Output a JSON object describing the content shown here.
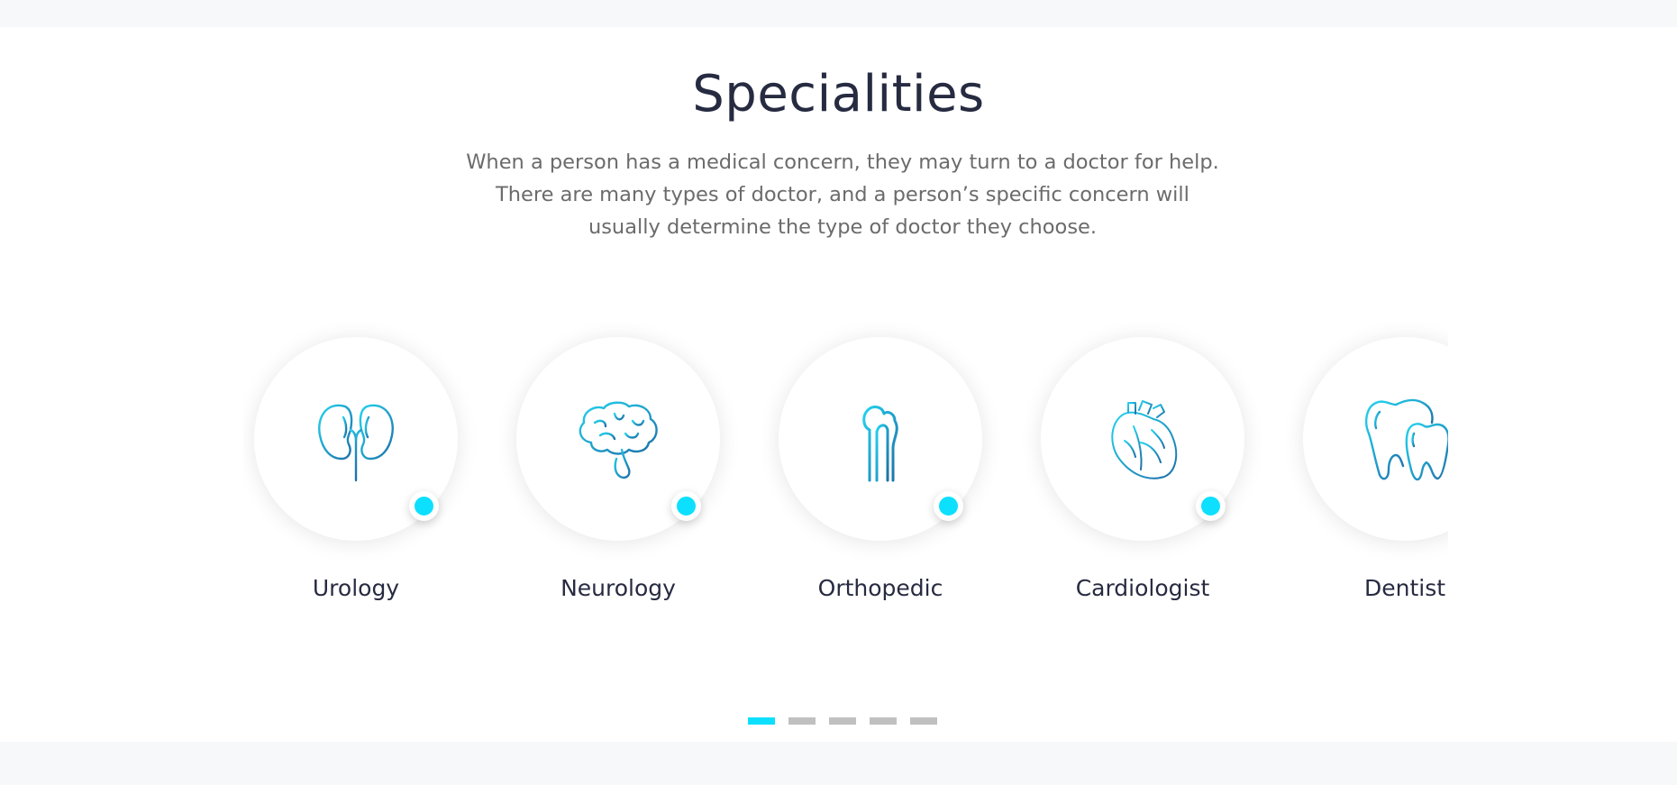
{
  "section": {
    "title": "Specialities",
    "description_lines": [
      "When a person has a medical concern, they may turn to a doctor for help.",
      "There are many types of doctor, and a person’s specific concern will",
      "usually determine the type of doctor they choose."
    ]
  },
  "specialities": [
    {
      "label": "Urology",
      "icon": "kidneys-icon"
    },
    {
      "label": "Neurology",
      "icon": "brain-icon"
    },
    {
      "label": "Orthopedic",
      "icon": "bone-icon"
    },
    {
      "label": "Cardiologist",
      "icon": "heart-icon"
    },
    {
      "label": "Dentist",
      "icon": "teeth-icon"
    }
  ],
  "pagination": {
    "count": 5,
    "active_index": 0
  },
  "colors": {
    "accent": "#0de0fe",
    "icon_gradient_start": "#22d3ee",
    "icon_gradient_end": "#1e6fa8",
    "title": "#272b41",
    "text": "#6b6b6b",
    "inactive_dot": "#c0c0c0",
    "page_background": "#f7f8fa"
  }
}
